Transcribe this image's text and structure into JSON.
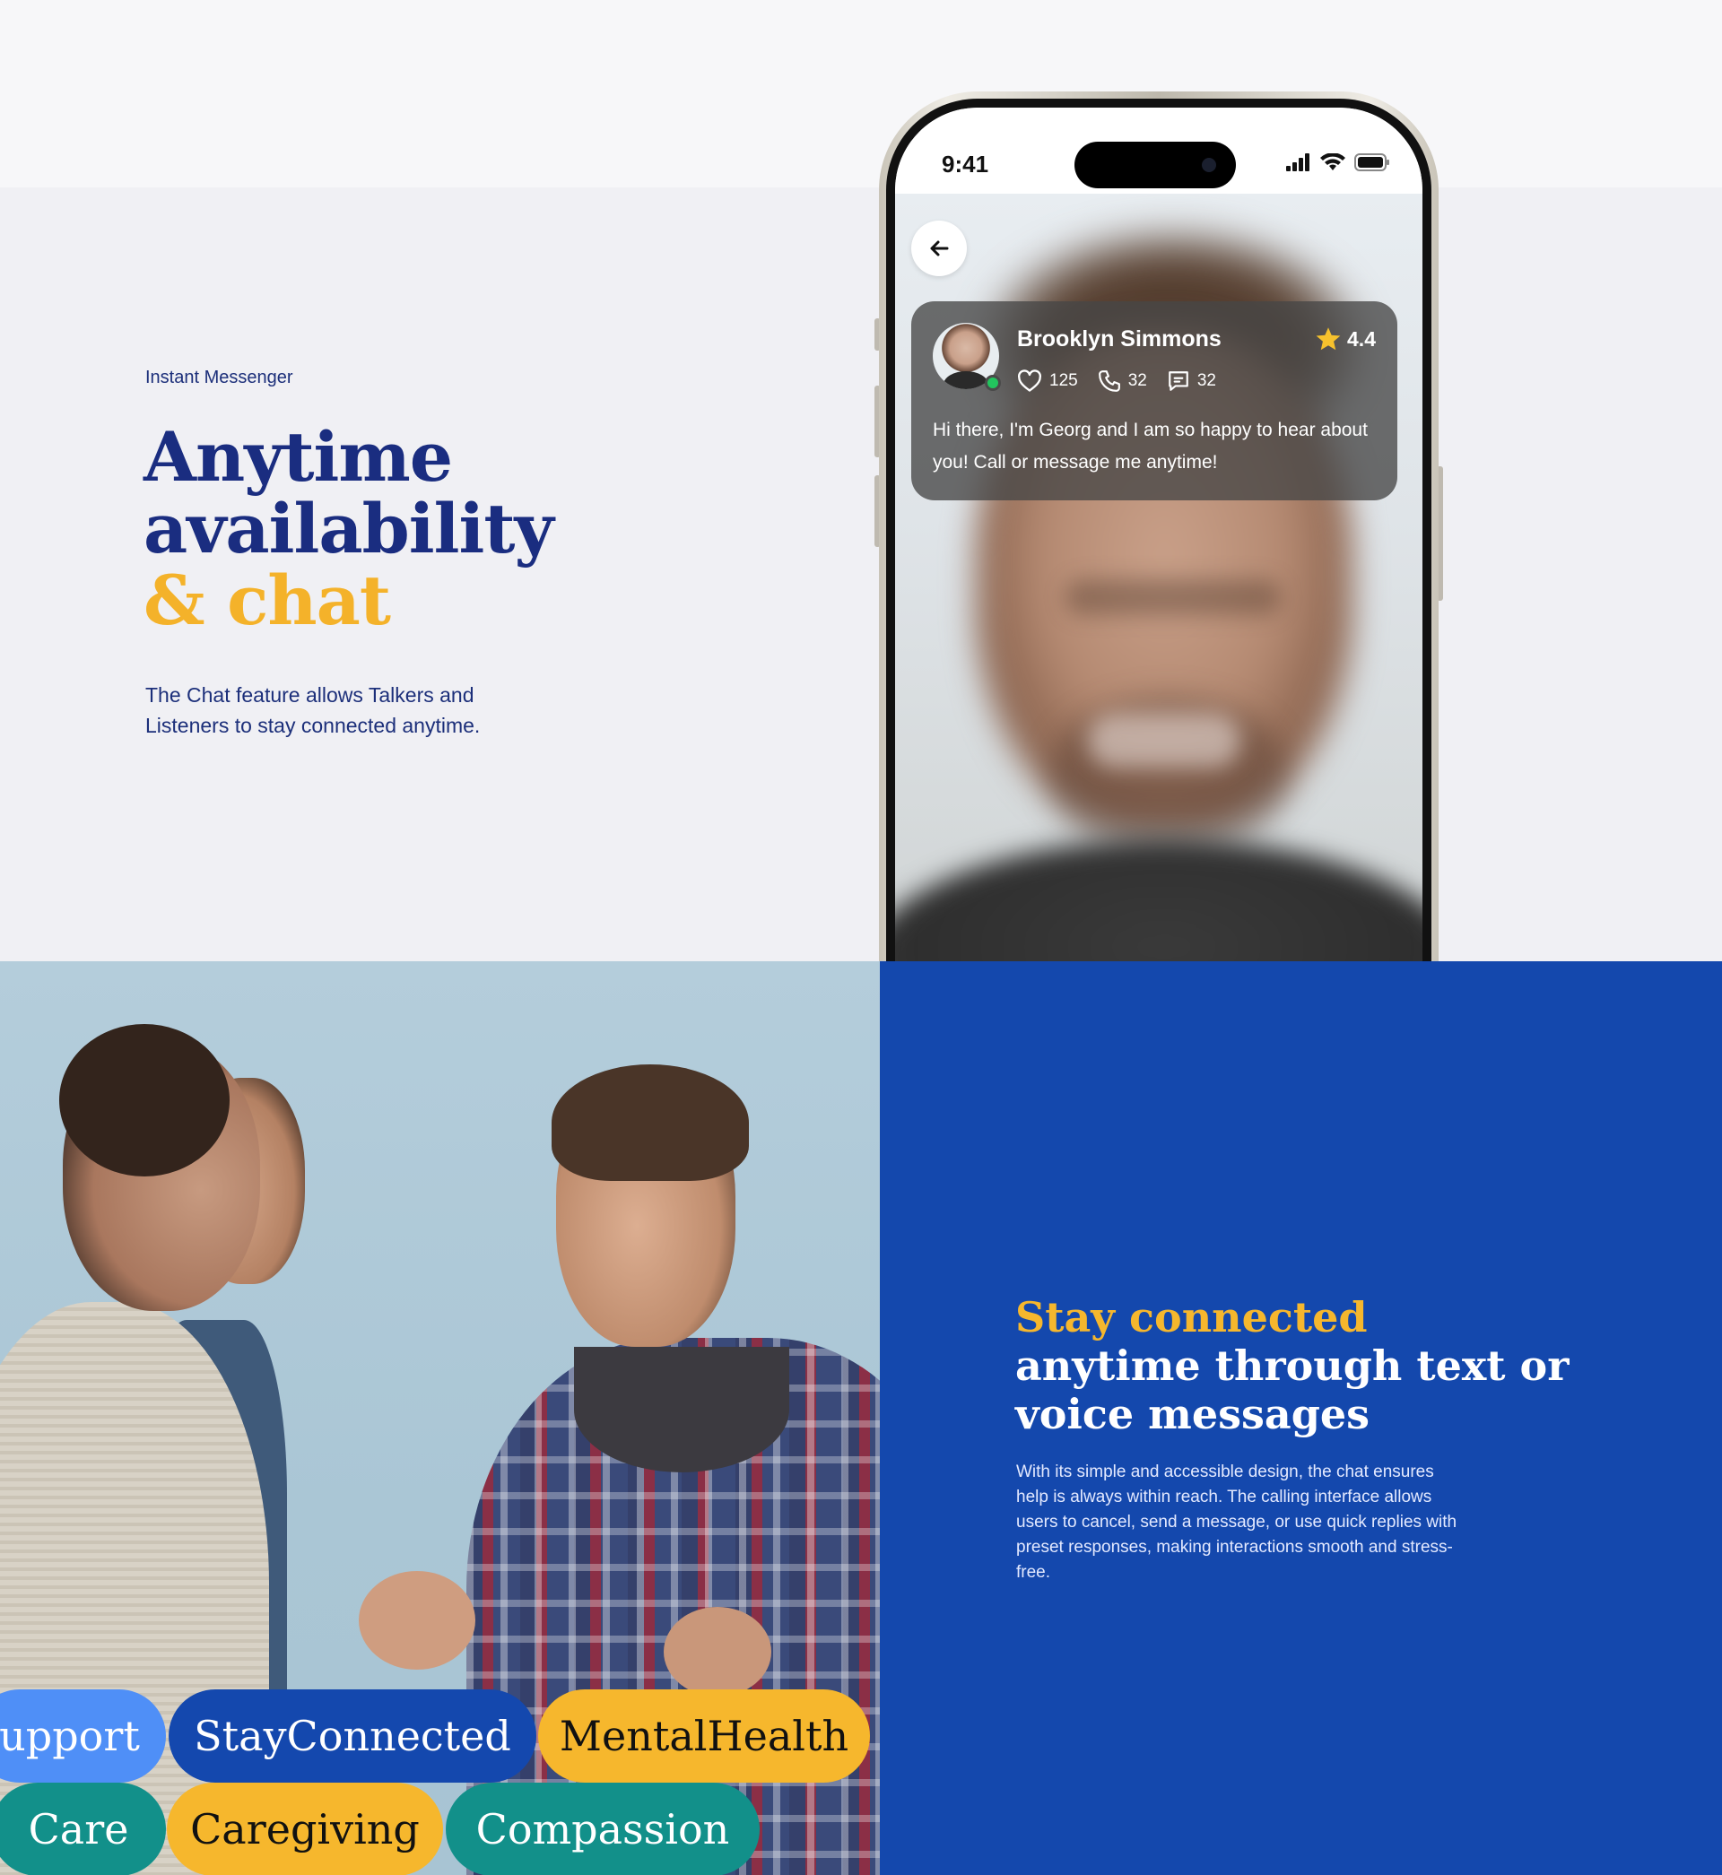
{
  "hero": {
    "eyebrow": "Instant Messenger",
    "headline_line1": "Anytime",
    "headline_line2": "availability",
    "headline_line3": "& chat",
    "description": "The Chat feature allows Talkers and Listeners to stay connected anytime."
  },
  "phone": {
    "status_time": "9:41",
    "status_icons": [
      "signal-icon",
      "wifi-icon",
      "battery-icon"
    ],
    "back_icon": "arrow-left-icon",
    "profile": {
      "name": "Brooklyn Simmons",
      "rating": "4.4",
      "likes": "125",
      "calls": "32",
      "messages": "32",
      "message": "Hi there, I'm Georg and I am so happy to hear about you! Call or message me anytime!",
      "online": true
    }
  },
  "tags": {
    "row1": [
      "upport",
      "StayConnected",
      "MentalHealth"
    ],
    "row2": [
      "Care",
      "Caregiving",
      "Compassion"
    ]
  },
  "feature": {
    "title_highlight": "Stay connected",
    "title_line2": "anytime through text or",
    "title_line3": "voice messages",
    "description": "With its simple and accessible design, the chat ensures help is always within reach. The calling interface allows users to cancel, send a message, or use quick replies with preset responses, making interactions smooth and stress-free."
  },
  "colors": {
    "navy": "#1a2d80",
    "accent_yellow": "#f6b72d",
    "brand_blue": "#1448ad",
    "teal": "#12908a",
    "light_blue": "#4f8ff7"
  }
}
